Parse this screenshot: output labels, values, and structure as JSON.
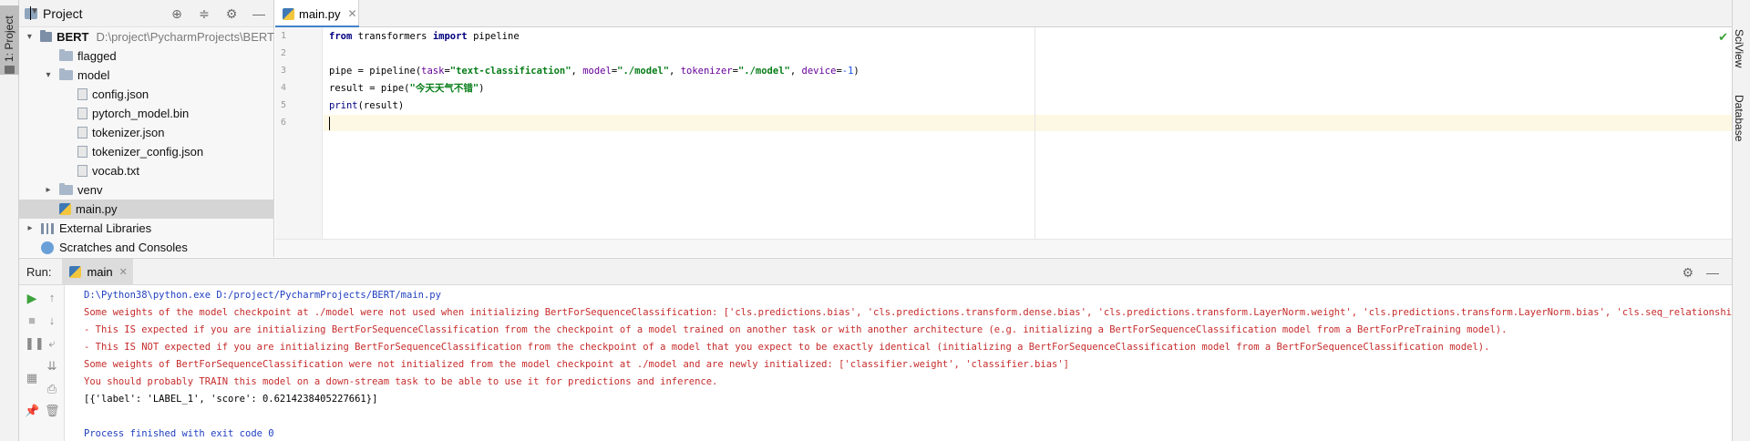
{
  "sidebar_left": {
    "tab_label": "1: Project"
  },
  "sidebar_right": {
    "tabs": [
      "SciView",
      "Database"
    ]
  },
  "project": {
    "title": "Project",
    "tree": [
      {
        "label": "BERT",
        "hint": "D:\\project\\PycharmProjects\\BERT",
        "type": "folder",
        "level": 0,
        "expanded": true
      },
      {
        "label": "flagged",
        "type": "folder",
        "level": 1
      },
      {
        "label": "model",
        "type": "folder",
        "level": 1,
        "expanded": true
      },
      {
        "label": "config.json",
        "type": "file",
        "level": 2
      },
      {
        "label": "pytorch_model.bin",
        "type": "file",
        "level": 2
      },
      {
        "label": "tokenizer.json",
        "type": "file",
        "level": 2
      },
      {
        "label": "tokenizer_config.json",
        "type": "file",
        "level": 2
      },
      {
        "label": "vocab.txt",
        "type": "file",
        "level": 2
      },
      {
        "label": "venv",
        "type": "folder",
        "level": 1,
        "expanded": false
      },
      {
        "label": "main.py",
        "type": "py",
        "level": 1,
        "selected": true
      },
      {
        "label": "External Libraries",
        "type": "libs",
        "level": 0,
        "expanded": false
      },
      {
        "label": "Scratches and Consoles",
        "type": "scratch",
        "level": 0
      }
    ]
  },
  "editor": {
    "tab_label": "main.py",
    "line_numbers": [
      "1",
      "2",
      "3",
      "4",
      "5",
      "6"
    ],
    "lines": [
      "from transformers import pipeline",
      "",
      "pipe = pipeline(task=\"text-classification\", model=\"./model\", tokenizer=\"./model\", device=-1)",
      "result = pipe(\"今天天气不错\")",
      "print(result)",
      ""
    ],
    "tokens": {
      "l1_from": "from",
      "l1_mod": " transformers ",
      "l1_import": "import",
      "l1_name": " pipeline",
      "l3_a": "pipe = pipeline(",
      "l3_p1": "task",
      "l3_eq1": "=",
      "l3_s1": "\"text-classification\"",
      "l3_c1": ", ",
      "l3_p2": "model",
      "l3_eq2": "=",
      "l3_s2": "\"./model\"",
      "l3_c2": ", ",
      "l3_p3": "tokenizer",
      "l3_eq3": "=",
      "l3_s3": "\"./model\"",
      "l3_c3": ", ",
      "l3_p4": "device",
      "l3_eq4": "=",
      "l3_n4": "-1",
      "l3_end": ")",
      "l4_a": "result = pipe(",
      "l4_s": "\"今天天气不错\"",
      "l4_end": ")",
      "l5_print": "print",
      "l5_rest": "(result)"
    }
  },
  "run": {
    "label": "Run:",
    "tab_label": "main",
    "console": [
      {
        "kind": "cmd",
        "text": "D:\\Python38\\python.exe D:/project/PycharmProjects/BERT/main.py"
      },
      {
        "kind": "err",
        "text": "Some weights of the model checkpoint at ./model were not used when initializing BertForSequenceClassification: ['cls.predictions.bias', 'cls.predictions.transform.dense.bias', 'cls.predictions.transform.LayerNorm.weight', 'cls.predictions.transform.LayerNorm.bias', 'cls.seq_relationship.bias', 'cls.p"
      },
      {
        "kind": "err",
        "text": "- This IS expected if you are initializing BertForSequenceClassification from the checkpoint of a model trained on another task or with another architecture (e.g. initializing a BertForSequenceClassification model from a BertForPreTraining model)."
      },
      {
        "kind": "err",
        "text": "- This IS NOT expected if you are initializing BertForSequenceClassification from the checkpoint of a model that you expect to be exactly identical (initializing a BertForSequenceClassification model from a BertForSequenceClassification model)."
      },
      {
        "kind": "err",
        "text": "Some weights of BertForSequenceClassification were not initialized from the model checkpoint at ./model and are newly initialized: ['classifier.weight', 'classifier.bias']"
      },
      {
        "kind": "err",
        "text": "You should probably TRAIN this model on a down-stream task to be able to use it for predictions and inference."
      },
      {
        "kind": "out",
        "text": "[{'label': 'LABEL_1', 'score': 0.6214238405227661}]"
      },
      {
        "kind": "out",
        "text": ""
      },
      {
        "kind": "cmd",
        "text": "Process finished with exit code 0"
      }
    ]
  },
  "colors": {
    "accent": "#4083c9",
    "error": "#c62b2b",
    "keyword": "#000080",
    "string": "#067d17",
    "param": "#660099"
  },
  "icons": {
    "locate": "crosshair-icon",
    "collapse": "collapse-all-icon",
    "settings": "gear-icon",
    "hide": "minimize-icon"
  }
}
